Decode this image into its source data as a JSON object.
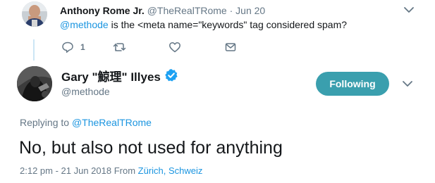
{
  "parent_tweet": {
    "name": "Anthony Rome Jr.",
    "handle": "@TheRealTRome",
    "separator": "·",
    "date": "Jun 20",
    "mention": "@methode",
    "text": " is the <meta name=\"keywords\" tag considered spam?",
    "reply_count": "1",
    "icons": [
      "reply-icon",
      "retweet-icon",
      "like-icon",
      "direct-message-icon",
      "chevron-down-icon"
    ]
  },
  "main_tweet": {
    "name": "Gary \"鯨理\" Illyes",
    "handle": "@methode",
    "follow_label": "Following",
    "replying_prefix": "Replying to ",
    "replying_handle": "@TheRealTRome",
    "text": "No, but also not used for anything",
    "time_date": "2:12 pm - 21 Jun 2018 From ",
    "location": "Zürich, Schweiz",
    "icons": [
      "verified-badge-icon",
      "chevron-down-icon"
    ]
  },
  "colors": {
    "link": "#1b95e0",
    "follow_button": "#3a9fae",
    "muted": "#657786",
    "verified": "#1da1f2",
    "thread_line": "#cce6f5"
  }
}
